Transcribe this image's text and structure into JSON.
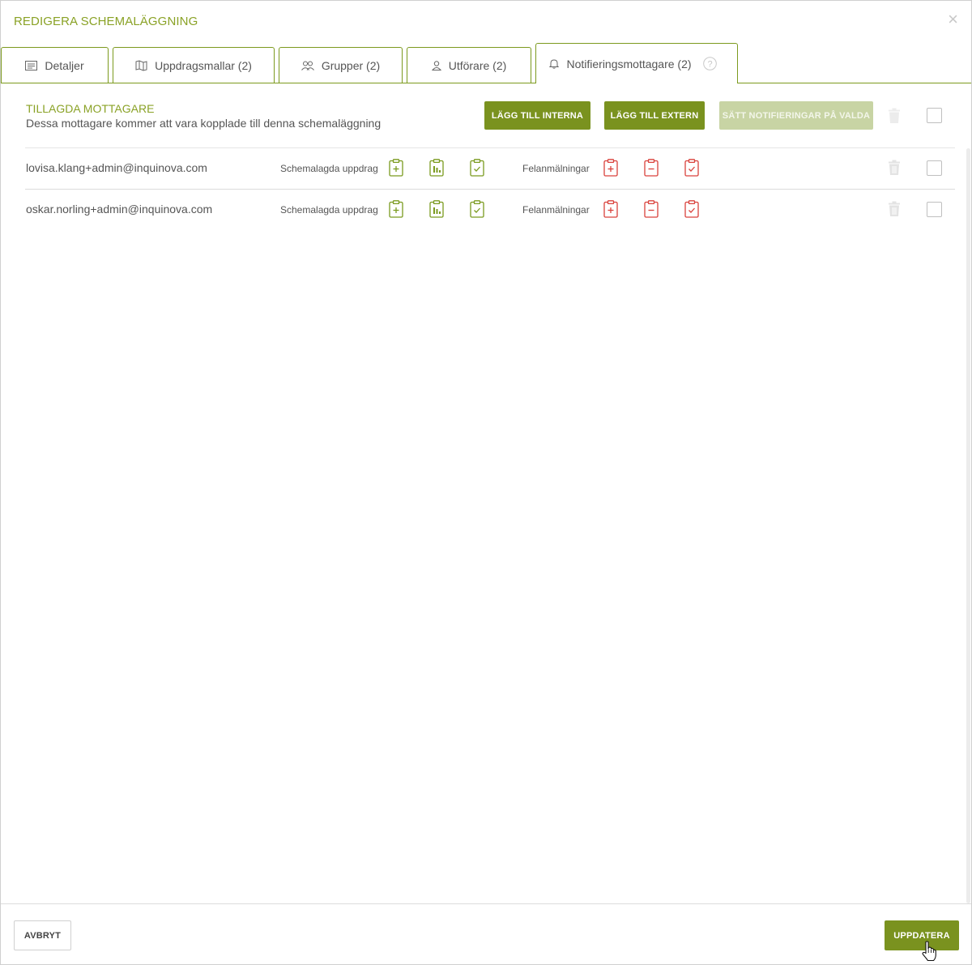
{
  "modal": {
    "title": "REDIGERA SCHEMALÄGGNING",
    "close_symbol": "×"
  },
  "tabs": [
    {
      "label": "Detaljer",
      "icon": "list-icon"
    },
    {
      "label": "Uppdragsmallar (2)",
      "icon": "map-icon"
    },
    {
      "label": "Grupper (2)",
      "icon": "users-icon"
    },
    {
      "label": "Utförare (2)",
      "icon": "user-icon"
    },
    {
      "label": "Notifieringsmottagare (2)",
      "icon": "bell-icon",
      "active": true
    }
  ],
  "section": {
    "title": "TILLAGDA MOTTAGARE",
    "subtitle": "Dessa mottagare kommer att vara kopplade till denna schemaläggning"
  },
  "actions": {
    "add_internal": "LÄGG TILL INTERNA",
    "add_external": "LÄGG TILL EXTERN",
    "set_notifications": "SÄTT NOTIFIERINGAR PÅ VALDA"
  },
  "recipients": [
    {
      "email": "lovisa.klang+admin@inquinova.com",
      "scheduled_label": "Schemalagda uppdrag",
      "fault_label": "Felanmälningar"
    },
    {
      "email": "oskar.norling+admin@inquinova.com",
      "scheduled_label": "Schemalagda uppdrag",
      "fault_label": "Felanmälningar"
    }
  ],
  "footer": {
    "cancel": "AVBRYT",
    "update": "UPPDATERA"
  },
  "colors": {
    "accent": "#7a921f",
    "title_green": "#8aa226",
    "icon_green": "#7a9a1e",
    "icon_red": "#d9423c",
    "disabled": "#c8d4a4"
  }
}
